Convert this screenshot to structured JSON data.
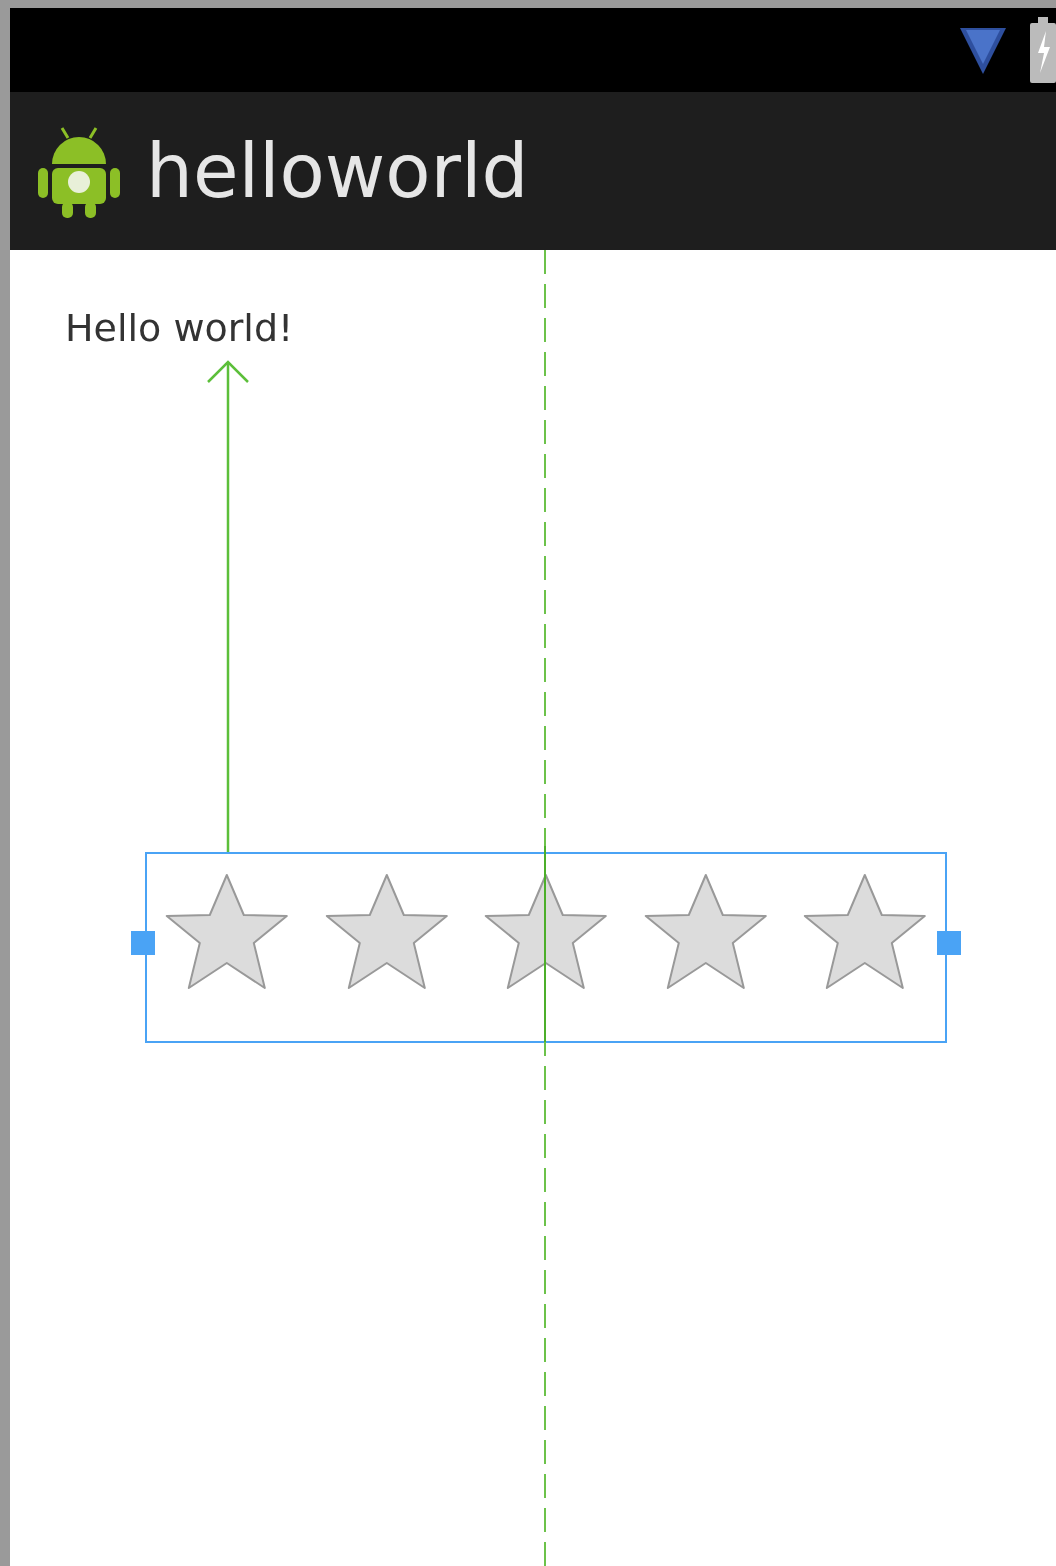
{
  "app_bar": {
    "title": "helloworld"
  },
  "text_view": {
    "text": "Hello world!"
  },
  "rating_bar": {
    "selected": true,
    "stars": 0
  }
}
